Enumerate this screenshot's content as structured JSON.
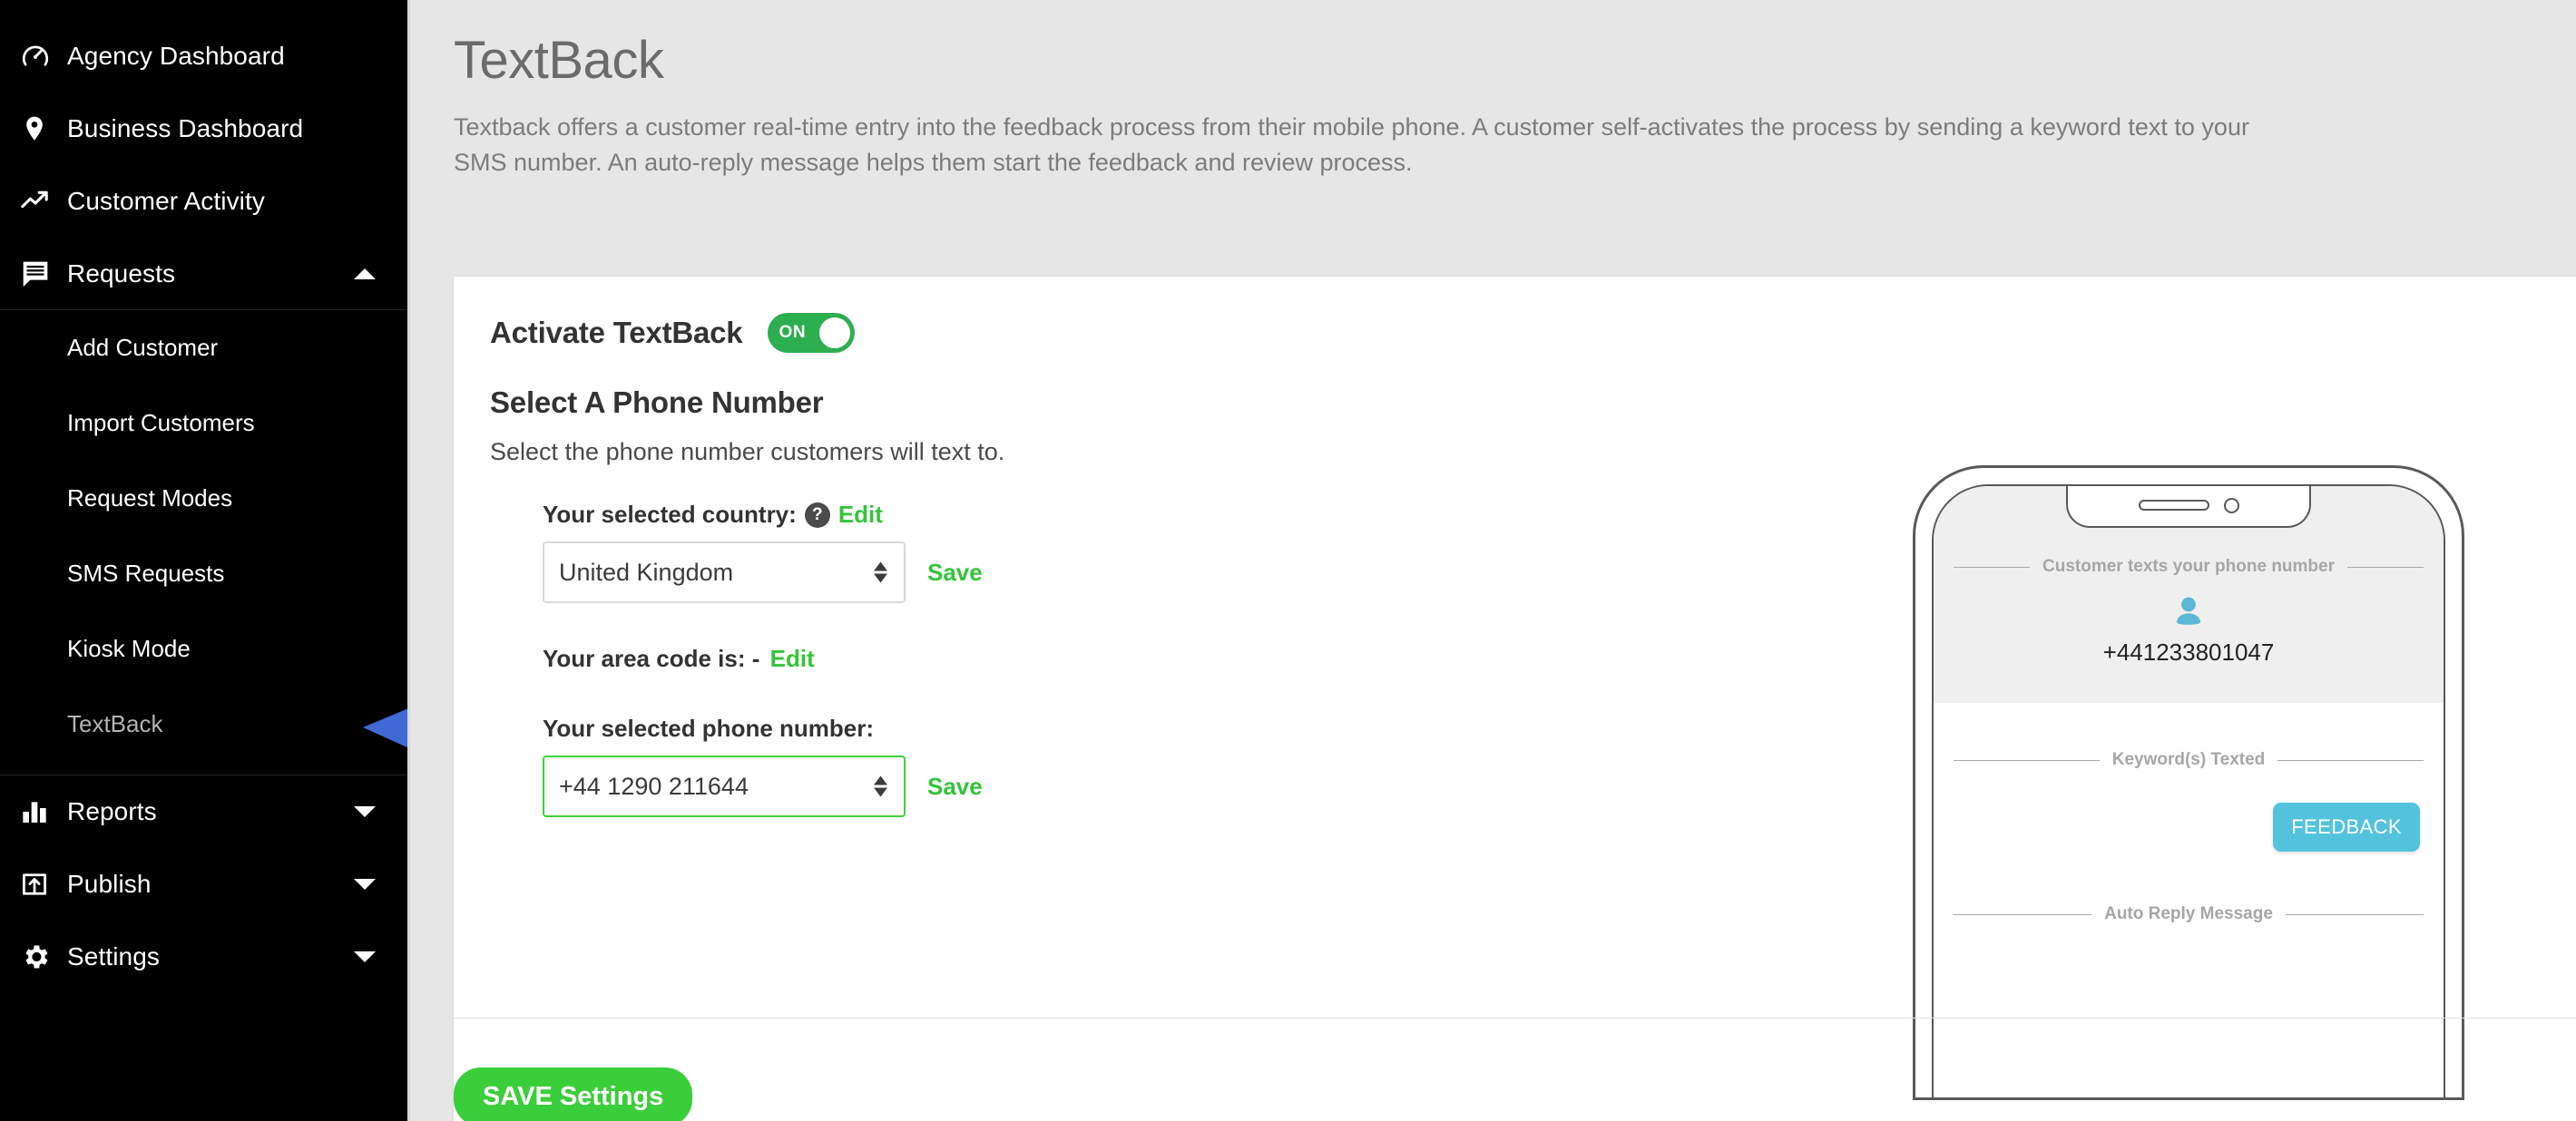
{
  "sidebar": {
    "items": [
      {
        "label": "Agency Dashboard",
        "icon": "speedometer-icon",
        "expandable": false
      },
      {
        "label": "Business Dashboard",
        "icon": "map-pin-icon",
        "expandable": false
      },
      {
        "label": "Customer Activity",
        "icon": "trend-up-icon",
        "expandable": false
      },
      {
        "label": "Requests",
        "icon": "message-list-icon",
        "expandable": true,
        "expanded": true
      }
    ],
    "sub_items": [
      {
        "label": "Add Customer",
        "active": false
      },
      {
        "label": "Import Customers",
        "active": false
      },
      {
        "label": "Request Modes",
        "active": false
      },
      {
        "label": "SMS Requests",
        "active": false
      },
      {
        "label": "Kiosk Mode",
        "active": false
      },
      {
        "label": "TextBack",
        "active": true
      }
    ],
    "bottom_items": [
      {
        "label": "Reports",
        "icon": "bar-chart-icon",
        "expandable": true
      },
      {
        "label": "Publish",
        "icon": "publish-upload-icon",
        "expandable": true
      },
      {
        "label": "Settings",
        "icon": "gear-icon",
        "expandable": true
      }
    ],
    "annotation_arrow_color": "#4169d6"
  },
  "page": {
    "title": "TextBack",
    "description": "Textback offers a customer real-time entry into the feedback process from their mobile phone. A customer self-activates the process by sending a keyword text to your SMS number. An auto-reply message helps them start the feedback and review process."
  },
  "card": {
    "activate": {
      "label": "Activate TextBack",
      "toggle_state": "ON",
      "toggle_color": "#2dae4f"
    },
    "phone_section": {
      "title": "Select A Phone Number",
      "subtitle": "Select the phone number customers will text to.",
      "country": {
        "label": "Your selected country:",
        "help_glyph": "?",
        "edit_label": "Edit",
        "selected_value": "United Kingdom",
        "save_label": "Save"
      },
      "area_code": {
        "label": "Your area code is: -",
        "edit_label": "Edit"
      },
      "number": {
        "label": "Your selected phone number:",
        "selected_value": "+44 1290 211644",
        "save_label": "Save",
        "highlight_color": "#3fd23f"
      }
    },
    "save_settings_label": "SAVE Settings",
    "save_settings_color": "#3bce3b"
  },
  "phone_preview": {
    "step1_label": "Customer texts your phone number",
    "displayed_number": "+441233801047",
    "step2_label": "Keyword(s) Texted",
    "keyword_bubble": "FEEDBACK",
    "keyword_bubble_color": "#53c3dd",
    "step3_label": "Auto Reply Message",
    "person_icon_color": "#5bb8d4"
  }
}
